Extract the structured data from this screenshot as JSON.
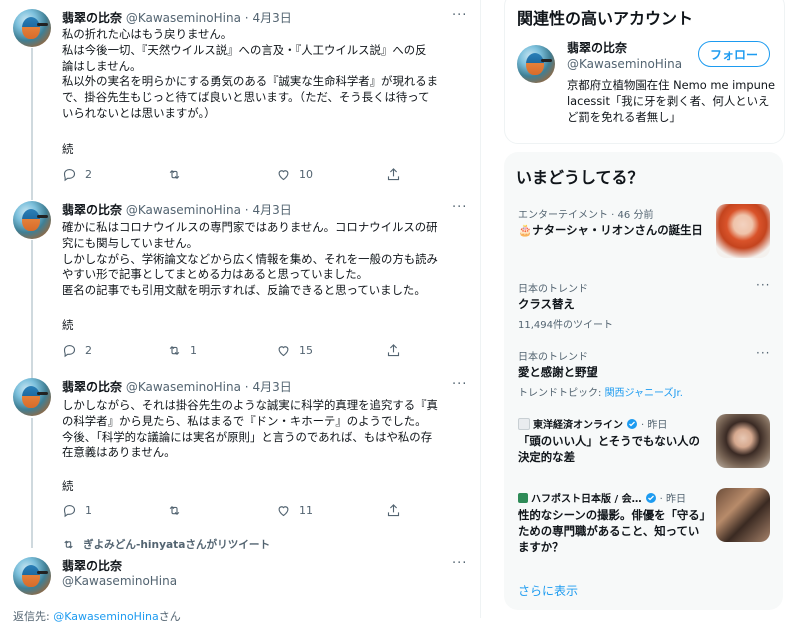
{
  "tweets": [
    {
      "name": "翡翠の比奈",
      "handle": "@KawaseminoHina",
      "dot": "·",
      "date": "4月3日",
      "lines": [
        "私の折れた心はもう戻りません。",
        "私は今後一切、『天然ウイルス説』への言及・『人工ウイルス説』への反",
        "論はしません。",
        "私以外の実名を明らかにする勇気のある『誠実な生命科学者』が現れるま",
        "で、掛谷先生もじっと待てば良いと思います。（ただ、そう長くは待って",
        "いられないとは思いますが。）"
      ],
      "cont": "続",
      "replies": "2",
      "retweets": "",
      "likes": "10"
    },
    {
      "name": "翡翠の比奈",
      "handle": "@KawaseminoHina",
      "dot": "·",
      "date": "4月3日",
      "lines": [
        "確かに私はコロナウイルスの専門家ではありません。コロナウイルスの研",
        "究にも関与していません。",
        "しかしながら、学術論文などから広く情報を集め、それを一般の方も読み",
        "やすい形で記事としてまとめる力はあると思っていました。",
        "匿名の記事でも引用文献を明示すれば、反論できると思っていました。"
      ],
      "cont": "続",
      "replies": "2",
      "retweets": "1",
      "likes": "15"
    },
    {
      "name": "翡翠の比奈",
      "handle": "@KawaseminoHina",
      "dot": "·",
      "date": "4月3日",
      "lines": [
        "しかしながら、それは掛谷先生のような誠実に科学的真理を追究する『真",
        "の科学者』から見たら、私はまるで『ドン・キホーテ』のようでした。",
        "今後、「科学的な議論には実名が原則」と言うのであれば、もはや私の存",
        "在意義はありません。"
      ],
      "cont": "続",
      "replies": "1",
      "retweets": "",
      "likes": "11"
    }
  ],
  "retweet_note": "ぎよみどん-hinyataさんがリツイート",
  "last_tweet": {
    "name": "翡翠の比奈",
    "handle": "@KawaseminoHina"
  },
  "reply_to": {
    "prefix": "返信先: ",
    "link": "@KawaseminoHina",
    "suffix": "さん"
  },
  "more_glyph": "···",
  "relevant": {
    "title": "関連性の高いアカウント",
    "name": "翡翠の比奈",
    "handle": "@KawaseminoHina",
    "follow": "フォロー",
    "bio": "京都府立植物園在住 Nemo me impune lacessit「我に牙を剥く者、何人といえど罰を免れる者無し」"
  },
  "trends": {
    "title": "いまどうしてる？",
    "items": [
      {
        "meta": "エンターテイメント · 46 分前",
        "title": "🎂ナターシャ・リオンさんの誕生日",
        "sub": ""
      },
      {
        "meta": "日本のトレンド",
        "title": "クラス替え",
        "sub": "11,494件のツイート"
      },
      {
        "meta": "日本のトレンド",
        "title": "愛と感謝と野望",
        "sub_prefix": "トレンドトピック: ",
        "sub_link": "関西ジャニーズJr."
      },
      {
        "meta_source": "東洋経済オンライン",
        "meta_time": "· 昨日",
        "title": "「頭のいい人」とそうでもない人の決定的な差"
      },
      {
        "meta_source": "ハフポスト日本版 / 会…",
        "meta_time": "· 昨日",
        "title": "性的なシーンの撮影。俳優を「守る」ための専門職があること、知っていますか？"
      }
    ],
    "show_more": "さらに表示"
  },
  "colors": {
    "accent": "#1d9bf0",
    "muted": "#536471",
    "text": "#0f1419"
  }
}
